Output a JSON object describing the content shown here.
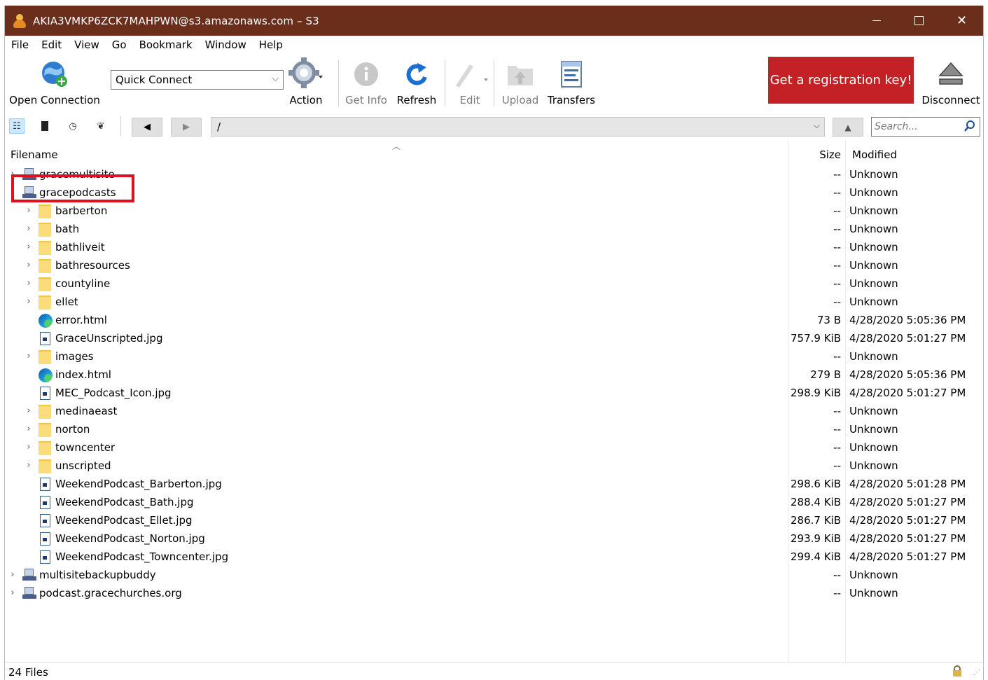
{
  "window": {
    "title": "AKIA3VMKP6ZCK7MAHPWN@s3.amazonaws.com – S3",
    "controls": {
      "minimize": "minimize",
      "maximize": "maximize",
      "close": "✕"
    }
  },
  "menu": [
    "File",
    "Edit",
    "View",
    "Go",
    "Bookmark",
    "Window",
    "Help"
  ],
  "toolbar": {
    "open_connection": "Open Connection",
    "quick_connect": "Quick Connect",
    "action": "Action",
    "get_info": "Get Info",
    "refresh": "Refresh",
    "edit": "Edit",
    "upload": "Upload",
    "transfers": "Transfers",
    "registration": "Get a registration key!",
    "disconnect": "Disconnect"
  },
  "nav": {
    "path": "/",
    "search_placeholder": "Search..."
  },
  "columns": {
    "filename": "Filename",
    "size": "Size",
    "modified": "Modified"
  },
  "rows": [
    {
      "name": "gracemultisite",
      "type": "bucket",
      "level": 0,
      "expander": "›",
      "size": "--",
      "modified": "Unknown"
    },
    {
      "name": "gracepodcasts",
      "type": "bucket",
      "level": 0,
      "expander": "˅",
      "size": "--",
      "modified": "Unknown"
    },
    {
      "name": "barberton",
      "type": "folder",
      "level": 1,
      "expander": "›",
      "size": "--",
      "modified": "Unknown"
    },
    {
      "name": "bath",
      "type": "folder",
      "level": 1,
      "expander": "›",
      "size": "--",
      "modified": "Unknown"
    },
    {
      "name": "bathliveit",
      "type": "folder",
      "level": 1,
      "expander": "›",
      "size": "--",
      "modified": "Unknown"
    },
    {
      "name": "bathresources",
      "type": "folder",
      "level": 1,
      "expander": "›",
      "size": "--",
      "modified": "Unknown"
    },
    {
      "name": "countyline",
      "type": "folder",
      "level": 1,
      "expander": "›",
      "size": "--",
      "modified": "Unknown"
    },
    {
      "name": "ellet",
      "type": "folder",
      "level": 1,
      "expander": "›",
      "size": "--",
      "modified": "Unknown"
    },
    {
      "name": "error.html",
      "type": "html",
      "level": 1,
      "expander": "",
      "size": "73 B",
      "modified": "4/28/2020 5:05:36 PM"
    },
    {
      "name": "GraceUnscripted.jpg",
      "type": "image",
      "level": 1,
      "expander": "",
      "size": "757.9 KiB",
      "modified": "4/28/2020 5:01:27 PM"
    },
    {
      "name": "images",
      "type": "folder",
      "level": 1,
      "expander": "›",
      "size": "--",
      "modified": "Unknown"
    },
    {
      "name": "index.html",
      "type": "html",
      "level": 1,
      "expander": "",
      "size": "279 B",
      "modified": "4/28/2020 5:05:36 PM"
    },
    {
      "name": "MEC_Podcast_Icon.jpg",
      "type": "image",
      "level": 1,
      "expander": "",
      "size": "298.9 KiB",
      "modified": "4/28/2020 5:01:27 PM"
    },
    {
      "name": "medinaeast",
      "type": "folder",
      "level": 1,
      "expander": "›",
      "size": "--",
      "modified": "Unknown"
    },
    {
      "name": "norton",
      "type": "folder",
      "level": 1,
      "expander": "›",
      "size": "--",
      "modified": "Unknown"
    },
    {
      "name": "towncenter",
      "type": "folder",
      "level": 1,
      "expander": "›",
      "size": "--",
      "modified": "Unknown"
    },
    {
      "name": "unscripted",
      "type": "folder",
      "level": 1,
      "expander": "›",
      "size": "--",
      "modified": "Unknown"
    },
    {
      "name": "WeekendPodcast_Barberton.jpg",
      "type": "image",
      "level": 1,
      "expander": "",
      "size": "298.6 KiB",
      "modified": "4/28/2020 5:01:28 PM"
    },
    {
      "name": "WeekendPodcast_Bath.jpg",
      "type": "image",
      "level": 1,
      "expander": "",
      "size": "288.4 KiB",
      "modified": "4/28/2020 5:01:27 PM"
    },
    {
      "name": "WeekendPodcast_Ellet.jpg",
      "type": "image",
      "level": 1,
      "expander": "",
      "size": "286.7 KiB",
      "modified": "4/28/2020 5:01:27 PM"
    },
    {
      "name": "WeekendPodcast_Norton.jpg",
      "type": "image",
      "level": 1,
      "expander": "",
      "size": "293.9 KiB",
      "modified": "4/28/2020 5:01:27 PM"
    },
    {
      "name": "WeekendPodcast_Towncenter.jpg",
      "type": "image",
      "level": 1,
      "expander": "",
      "size": "299.4 KiB",
      "modified": "4/28/2020 5:01:27 PM"
    },
    {
      "name": "multisitebackupbuddy",
      "type": "bucket",
      "level": 0,
      "expander": "›",
      "size": "--",
      "modified": "Unknown"
    },
    {
      "name": "podcast.gracechurches.org",
      "type": "bucket",
      "level": 0,
      "expander": "›",
      "size": "--",
      "modified": "Unknown"
    }
  ],
  "status": {
    "text": "24 Files"
  },
  "colors": {
    "titlebar": "#6b2e1b",
    "registration": "#c42126",
    "highlight": "#e0101e"
  }
}
